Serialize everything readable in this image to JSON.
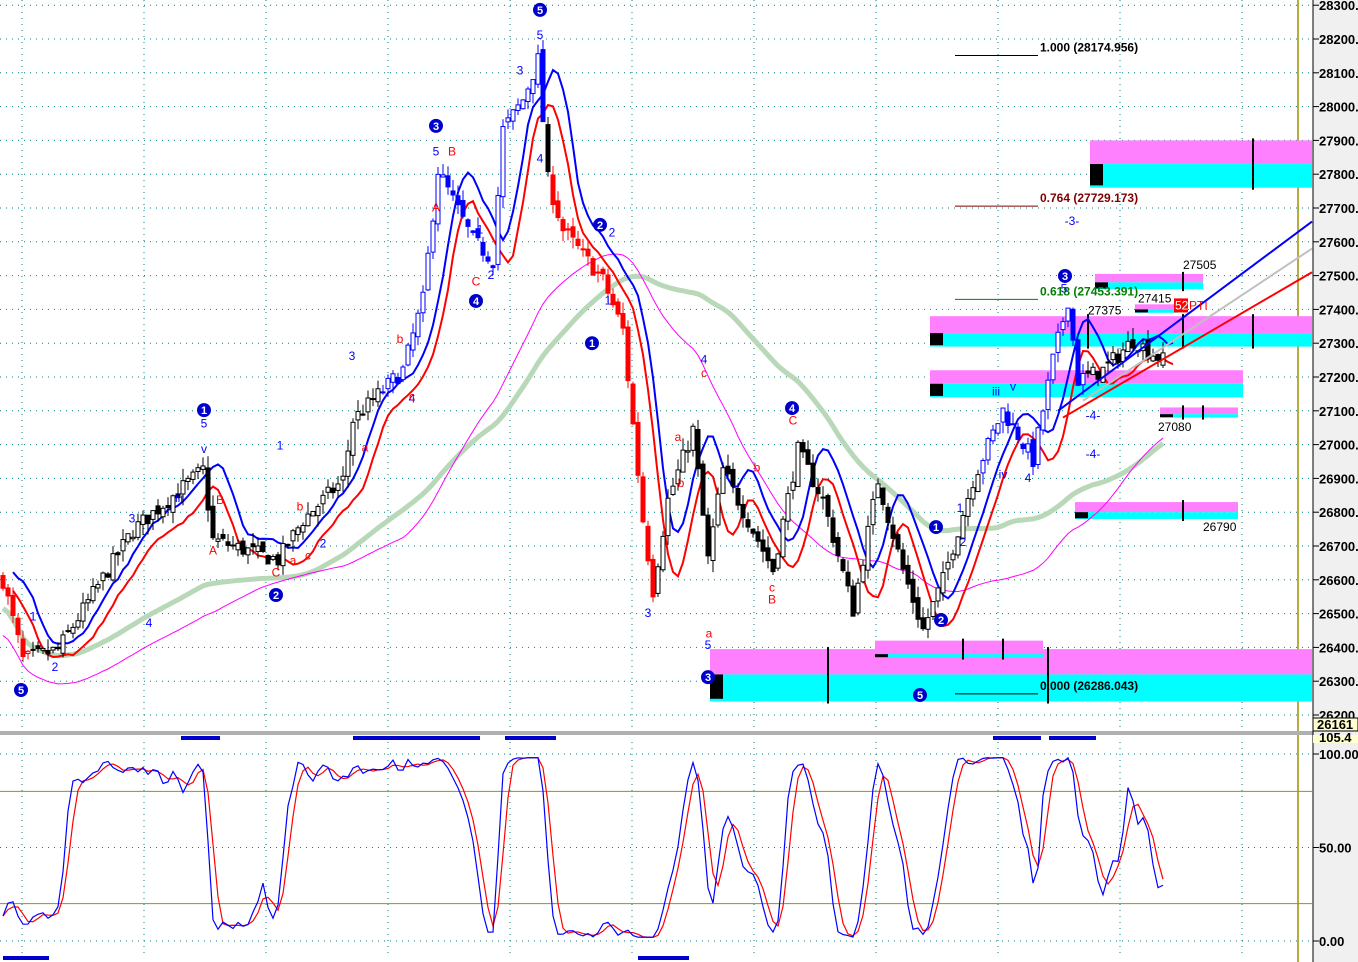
{
  "chart_data": {
    "type": "candlestick",
    "price_axis": {
      "ylim": [
        26161,
        28300
      ],
      "ticks": [
        "28300.",
        "28200.",
        "28100.",
        "28000.",
        "27900.",
        "27800.",
        "27700.",
        "27600.",
        "27500.",
        "27400.",
        "27300.",
        "27200.",
        "27100.",
        "27000.",
        "26900.",
        "26800.",
        "26700.",
        "26600.",
        "26500.",
        "26400.",
        "26300.",
        "26200."
      ],
      "tick_values": [
        28300,
        28200,
        28100,
        28000,
        27900,
        27800,
        27700,
        27600,
        27500,
        27400,
        27300,
        27200,
        27100,
        27000,
        26900,
        26800,
        26700,
        26600,
        26500,
        26400,
        26300,
        26200
      ]
    },
    "last_price_tag": "26161",
    "osc_axis": {
      "ylim": [
        0,
        100
      ],
      "ticks": [
        "100.00",
        "50.00",
        "0.00"
      ],
      "tick_values": [
        100,
        50,
        0
      ],
      "levels": [
        80,
        20
      ],
      "top_tag": "105.4"
    },
    "price_waypoints": [
      [
        0,
        26600
      ],
      [
        4,
        26363
      ],
      [
        11,
        26393
      ],
      [
        26,
        26747
      ],
      [
        40,
        26925
      ],
      [
        42,
        26718
      ],
      [
        55,
        26659
      ],
      [
        60,
        26777
      ],
      [
        68,
        26895
      ],
      [
        70,
        27073
      ],
      [
        80,
        27220
      ],
      [
        84,
        27428
      ],
      [
        87,
        27812
      ],
      [
        94,
        27605
      ],
      [
        98,
        27546
      ],
      [
        100,
        27931
      ],
      [
        104,
        28020
      ],
      [
        107,
        28138
      ],
      [
        109,
        27783
      ],
      [
        112,
        27635
      ],
      [
        120,
        27487
      ],
      [
        124,
        27339
      ],
      [
        128,
        26777
      ],
      [
        130,
        26570
      ],
      [
        133,
        26836
      ],
      [
        138,
        27043
      ],
      [
        141,
        26659
      ],
      [
        144,
        26925
      ],
      [
        150,
        26747
      ],
      [
        154,
        26629
      ],
      [
        159,
        26984
      ],
      [
        164,
        26836
      ],
      [
        170,
        26511
      ],
      [
        175,
        26895
      ],
      [
        180,
        26629
      ],
      [
        184,
        26452
      ],
      [
        188,
        26600
      ],
      [
        194,
        26895
      ],
      [
        200,
        27102
      ],
      [
        206,
        26954
      ],
      [
        210,
        27250
      ],
      [
        213,
        27428
      ],
      [
        215,
        27191
      ],
      [
        220,
        27220
      ],
      [
        226,
        27309
      ],
      [
        232,
        27250
      ]
    ],
    "bar_color_segments": [
      {
        "from": 0,
        "to": 5,
        "color": "#ff0000"
      },
      {
        "from": 76,
        "to": 108,
        "color": "#0000ff"
      },
      {
        "from": 110,
        "to": 130,
        "color": "#ff0000"
      },
      {
        "from": 196,
        "to": 216,
        "color": "#0000ff"
      }
    ],
    "fib_levels": [
      {
        "text": "1.000 (28174.956)",
        "price": 28174.956,
        "color": "#000000"
      },
      {
        "text": "0.764 (27729.173)",
        "price": 27729.173,
        "color": "#800000"
      },
      {
        "text": "0.618 (27453.391)",
        "price": 27453.391,
        "color": "#008000"
      },
      {
        "text": "0.000 (26286.043)",
        "price": 26286.043,
        "color": "#000000"
      }
    ],
    "zones": [
      {
        "from": 218,
        "to": 262,
        "top": 27900,
        "mid": 27830,
        "bottom": 27760,
        "ticks": [
          250
        ]
      },
      {
        "from": 186,
        "to": 262,
        "top": 27380,
        "mid": 27330,
        "bottom": 27290,
        "ticks": [
          217,
          236,
          250
        ]
      },
      {
        "from": 186,
        "to": 248,
        "top": 27220,
        "mid": 27180,
        "bottom": 27140,
        "ticks": []
      },
      {
        "from": 219,
        "to": 240,
        "top": 27505,
        "mid": 27480,
        "bottom": 27460,
        "ticks": [
          236
        ]
      },
      {
        "from": 227,
        "to": 235,
        "top": 27415,
        "mid": 27400,
        "bottom": 27390,
        "ticks": []
      },
      {
        "from": 232,
        "to": 247,
        "top": 27110,
        "mid": 27090,
        "bottom": 27080,
        "ticks": [
          236,
          240
        ]
      },
      {
        "from": 215,
        "to": 247,
        "top": 26830,
        "mid": 26800,
        "bottom": 26780,
        "ticks": [
          236
        ]
      },
      {
        "from": 142,
        "to": 262,
        "top": 26395,
        "mid": 26320,
        "bottom": 26240,
        "ticks": [
          165,
          209
        ]
      },
      {
        "from": 175,
        "to": 208,
        "top": 26420,
        "mid": 26380,
        "bottom": 26370,
        "ticks": [
          192,
          200
        ]
      }
    ],
    "price_labels": [
      {
        "text": "27505",
        "bar": 236,
        "price": 27520
      },
      {
        "text": "27415",
        "bar": 227,
        "price": 27420
      },
      {
        "text": "27375",
        "bar": 217,
        "price": 27385
      },
      {
        "text": "27080",
        "bar": 231,
        "price": 27040
      },
      {
        "text": "26790",
        "bar": 240,
        "price": 26745
      }
    ],
    "pti_tag": {
      "num": "52",
      "text": "PTI",
      "bar": 235,
      "price": 27400
    },
    "wave_circles": [
      {
        "text": "5",
        "bar": 3.6,
        "price": 26274
      },
      {
        "text": "1",
        "bar": 40.2,
        "price": 27102
      },
      {
        "text": "2",
        "bar": 54.6,
        "price": 26555
      },
      {
        "text": "3",
        "bar": 86.6,
        "price": 27943
      },
      {
        "text": "5",
        "bar": 107.4,
        "price": 28286
      },
      {
        "text": "4",
        "bar": 94.6,
        "price": 27425
      },
      {
        "text": "2",
        "bar": 119.4,
        "price": 27650
      },
      {
        "text": "1",
        "bar": 117.8,
        "price": 27300
      },
      {
        "text": "4",
        "bar": 157.8,
        "price": 27108
      },
      {
        "text": "3",
        "bar": 141,
        "price": 26312
      },
      {
        "text": "1",
        "bar": 186.6,
        "price": 26756
      },
      {
        "text": "2",
        "bar": 187.6,
        "price": 26481
      },
      {
        "text": "5",
        "bar": 183.4,
        "price": 26259
      },
      {
        "text": "3",
        "bar": 212.4,
        "price": 27499
      }
    ],
    "wave_labels": [
      {
        "text": "2",
        "bar": 10.4,
        "price": 26330,
        "color": "#0000ff"
      },
      {
        "text": "1",
        "bar": 6,
        "price": 26480,
        "color": "#0000ff"
      },
      {
        "text": "3",
        "bar": 25.8,
        "price": 26770,
        "color": "#0000ff"
      },
      {
        "text": "4",
        "bar": 29.2,
        "price": 26460,
        "color": "#0000ff"
      },
      {
        "text": "5",
        "bar": 40.2,
        "price": 27050,
        "color": "#0000ff"
      },
      {
        "text": "v",
        "bar": 40.2,
        "price": 26975,
        "color": "#0000ff"
      },
      {
        "text": "iii",
        "bar": 35.2,
        "price": 26830,
        "color": "#0000ff"
      },
      {
        "text": "1",
        "bar": 55.4,
        "price": 26985,
        "color": "#0000ff"
      },
      {
        "text": "2",
        "bar": 64,
        "price": 26695,
        "color": "#0000ff"
      },
      {
        "text": "3",
        "bar": 69.8,
        "price": 27250,
        "color": "#0000ff"
      },
      {
        "text": "4",
        "bar": 81.8,
        "price": 27125,
        "color": "#0000ff"
      },
      {
        "text": "5",
        "bar": 86.6,
        "price": 27855,
        "color": "#0000ff"
      },
      {
        "text": "1",
        "bar": 95.4,
        "price": 27625,
        "color": "#0000ff"
      },
      {
        "text": "2",
        "bar": 97.6,
        "price": 27490,
        "color": "#0000ff"
      },
      {
        "text": "3",
        "bar": 103.4,
        "price": 28095,
        "color": "#0000ff"
      },
      {
        "text": "5",
        "bar": 107.4,
        "price": 28200,
        "color": "#0000ff"
      },
      {
        "text": "4",
        "bar": 107.4,
        "price": 27835,
        "color": "#0000ff"
      },
      {
        "text": "2",
        "bar": 121.8,
        "price": 27615,
        "color": "#0000ff"
      },
      {
        "text": "1",
        "bar": 121,
        "price": 27415,
        "color": "#0000ff"
      },
      {
        "text": "3",
        "bar": 129,
        "price": 26490,
        "color": "#0000ff"
      },
      {
        "text": "4",
        "bar": 140.2,
        "price": 27240,
        "color": "#0000ff"
      },
      {
        "text": "5",
        "bar": 141,
        "price": 26395,
        "color": "#0000ff"
      },
      {
        "text": "2",
        "bar": 192,
        "price": 26700,
        "color": "#0000ff"
      },
      {
        "text": "1",
        "bar": 191.4,
        "price": 26800,
        "color": "#0000ff"
      },
      {
        "text": "4",
        "bar": 205,
        "price": 26890,
        "color": "#0000ff"
      },
      {
        "text": "iv",
        "bar": 200,
        "price": 26900,
        "color": "#0000ff"
      },
      {
        "text": "iii",
        "bar": 198.6,
        "price": 27145,
        "color": "#0000ff"
      },
      {
        "text": "v",
        "bar": 202,
        "price": 27160,
        "color": "#0000ff"
      },
      {
        "text": "5",
        "bar": 212.2,
        "price": 27450,
        "color": "#0000ff"
      },
      {
        "text": "-3-",
        "bar": 213.8,
        "price": 27650,
        "color": "#0000ff"
      },
      {
        "text": "-4-",
        "bar": 218,
        "price": 26960,
        "color": "#0000ff"
      },
      {
        "text": "-4-",
        "bar": 218,
        "price": 27075,
        "color": "#0000ff"
      },
      {
        "text": "B",
        "bar": 89.8,
        "price": 27855,
        "color": "#ff0000"
      },
      {
        "text": "A",
        "bar": 86.6,
        "price": 27690,
        "color": "#ff0000"
      },
      {
        "text": "C",
        "bar": 94.6,
        "price": 27470,
        "color": "#ff0000"
      },
      {
        "text": "B",
        "bar": 43.4,
        "price": 26825,
        "color": "#ff0000"
      },
      {
        "text": "A",
        "bar": 42,
        "price": 26675,
        "color": "#ff0000"
      },
      {
        "text": "C",
        "bar": 54.6,
        "price": 26610,
        "color": "#ff0000"
      },
      {
        "text": "a",
        "bar": 58,
        "price": 26645,
        "color": "#ff0000"
      },
      {
        "text": "c",
        "bar": 61,
        "price": 26660,
        "color": "#ff0000"
      },
      {
        "text": "b",
        "bar": 59.4,
        "price": 26805,
        "color": "#ff0000"
      },
      {
        "text": "a",
        "bar": 72.4,
        "price": 26980,
        "color": "#ff0000"
      },
      {
        "text": "b",
        "bar": 79.4,
        "price": 27300,
        "color": "#ff0000"
      },
      {
        "text": "c",
        "bar": 81.8,
        "price": 27130,
        "color": "#ff0000"
      },
      {
        "text": "c",
        "bar": 140.2,
        "price": 27200,
        "color": "#ff0000"
      },
      {
        "text": "a",
        "bar": 135,
        "price": 27010,
        "color": "#ff0000"
      },
      {
        "text": "b",
        "bar": 135.6,
        "price": 26875,
        "color": "#ff0000"
      },
      {
        "text": "a",
        "bar": 141.2,
        "price": 26430,
        "color": "#ff0000"
      },
      {
        "text": "C",
        "bar": 158,
        "price": 27060,
        "color": "#ff0000"
      },
      {
        "text": "b",
        "bar": 150.8,
        "price": 26920,
        "color": "#ff0000"
      },
      {
        "text": "c",
        "bar": 153.8,
        "price": 26565,
        "color": "#ff0000"
      },
      {
        "text": "B",
        "bar": 153.8,
        "price": 26530,
        "color": "#ff0000"
      }
    ],
    "trend_lines": [
      {
        "color": "#0000ff",
        "from": [
          211,
          27100
        ],
        "to": [
          262,
          27660
        ]
      },
      {
        "color": "#c0c0c0",
        "from": [
          216,
          27130
        ],
        "to": [
          262,
          27580
        ]
      },
      {
        "color": "#ff0000",
        "from": [
          212,
          27080
        ],
        "to": [
          262,
          27510
        ]
      }
    ],
    "signal_markers_top": [
      [
        35.6,
        43.4
      ],
      [
        70,
        95.4
      ],
      [
        100.4,
        110.6
      ],
      [
        198,
        207.6
      ],
      [
        209.2,
        218.6
      ]
    ],
    "signal_markers_bottom": [
      [
        0,
        9.2
      ],
      [
        127,
        137.2
      ]
    ],
    "grid": true
  }
}
